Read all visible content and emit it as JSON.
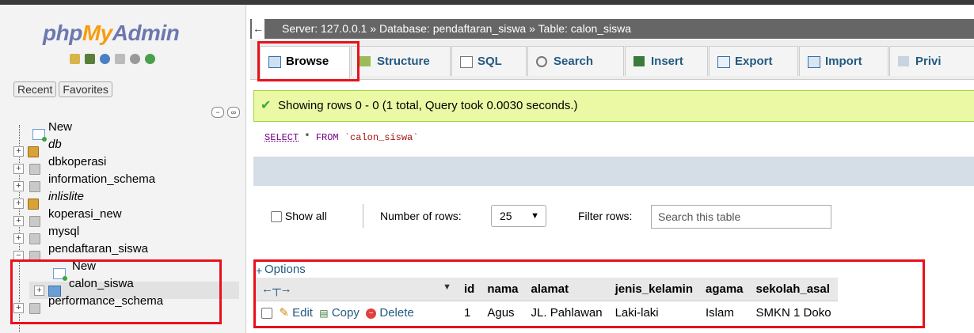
{
  "sidebar": {
    "logo": {
      "part1": "php",
      "part2": "My",
      "part3": "Admin"
    },
    "recent_tab": "Recent",
    "favorites_tab": "Favorites",
    "tree": [
      {
        "label": "New",
        "type": "new",
        "expander": ""
      },
      {
        "label": "db",
        "type": "special",
        "italic": true,
        "expander": "+"
      },
      {
        "label": "dbkoperasi",
        "type": "db",
        "expander": "+"
      },
      {
        "label": "information_schema",
        "type": "db",
        "expander": "+"
      },
      {
        "label": "inlislite",
        "type": "special",
        "italic": true,
        "expander": "+"
      },
      {
        "label": "koperasi_new",
        "type": "db",
        "expander": "+"
      },
      {
        "label": "mysql",
        "type": "db",
        "expander": "+"
      },
      {
        "label": "pendaftaran_siswa",
        "type": "db",
        "expander": "−"
      },
      {
        "label": "New",
        "type": "new",
        "expander": ""
      },
      {
        "label": "calon_siswa",
        "type": "table",
        "expander": "+"
      },
      {
        "label": "performance_schema",
        "type": "db",
        "expander": "+"
      }
    ]
  },
  "breadcrumb": {
    "server": "Server: 127.0.0.1",
    "database": "Database: pendaftaran_siswa",
    "table": "Table: calon_siswa",
    "separator": "»"
  },
  "tabs": [
    "Browse",
    "Structure",
    "SQL",
    "Search",
    "Insert",
    "Export",
    "Import",
    "Privi"
  ],
  "message": "Showing rows 0 - 0 (1 total, Query took 0.0030 seconds.)",
  "query": {
    "select": "SELECT",
    "rest": " * ",
    "from": "FROM",
    "table": "`calon_siswa`"
  },
  "controls": {
    "show_all": "Show all",
    "number_of_rows_label": "Number of rows:",
    "rows_value": "25",
    "filter_label": "Filter rows:",
    "filter_placeholder": "Search this table"
  },
  "options_label": "Options",
  "table": {
    "headers": [
      "id",
      "nama",
      "alamat",
      "jenis_kelamin",
      "agama",
      "sekolah_asal"
    ],
    "actions": {
      "edit": "Edit",
      "copy": "Copy",
      "delete": "Delete"
    },
    "rows": [
      [
        "1",
        "Agus",
        "JL. Pahlawan",
        "Laki-laki",
        "Islam",
        "SMKN 1 Doko"
      ]
    ]
  },
  "colors": {
    "highlight": "#e8111c",
    "link": "#235a81",
    "success_bg": "#ebf8a4"
  }
}
